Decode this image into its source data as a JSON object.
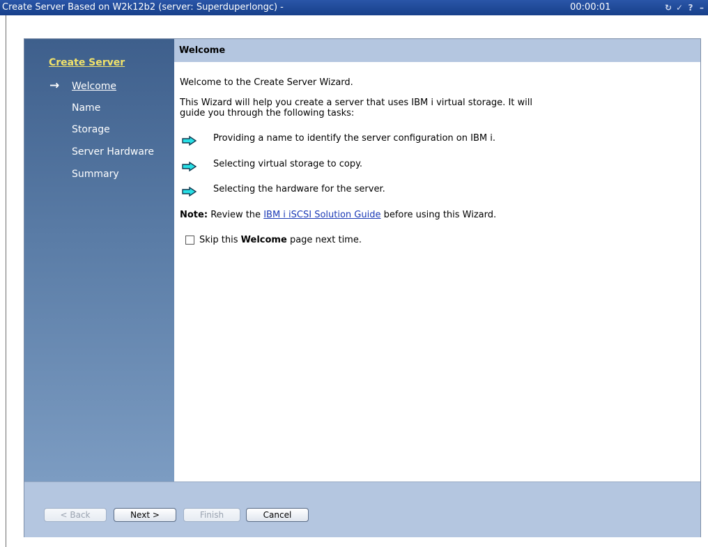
{
  "window": {
    "title": "Create Server Based on W2k12b2 (server: Superduperlongc) -",
    "timer": "00:00:01",
    "controls": [
      "refresh-icon",
      "edit-icon",
      "help-icon",
      "minimize-icon",
      "maximize-icon"
    ],
    "help_glyph": "?"
  },
  "nav": {
    "title": "Create Server",
    "items": [
      {
        "label": "Welcome",
        "current": true
      },
      {
        "label": "Name",
        "current": false
      },
      {
        "label": "Storage",
        "current": false
      },
      {
        "label": "Server Hardware",
        "current": false
      },
      {
        "label": "Summary",
        "current": false
      }
    ]
  },
  "content": {
    "header": "Welcome",
    "intro": "Welcome to the Create Server Wizard.",
    "description_line1": "This Wizard will help you create a server that uses IBM i virtual storage. It will",
    "description_line2": "guide you through the following tasks:",
    "tasks": [
      "Providing a name to identify the server configuration on IBM i.",
      "Selecting virtual storage to copy.",
      "Selecting the hardware for the server."
    ],
    "note_label": "Note:",
    "note_before": "Review the",
    "note_link": "IBM i iSCSI Solution Guide",
    "note_after": "before using this Wizard.",
    "skip_before": "Skip this",
    "skip_bold": "Welcome",
    "skip_after": "page next time.",
    "skip_checked": false
  },
  "buttons": {
    "back": "< Back",
    "next": "Next >",
    "finish": "Finish",
    "cancel": "Cancel"
  },
  "colors": {
    "titlebar": "#1d489a",
    "nav_title": "#f2e36a",
    "header_band": "#b4c6e0",
    "task_arrow": "#27e0e6",
    "link": "#1a39b6"
  }
}
